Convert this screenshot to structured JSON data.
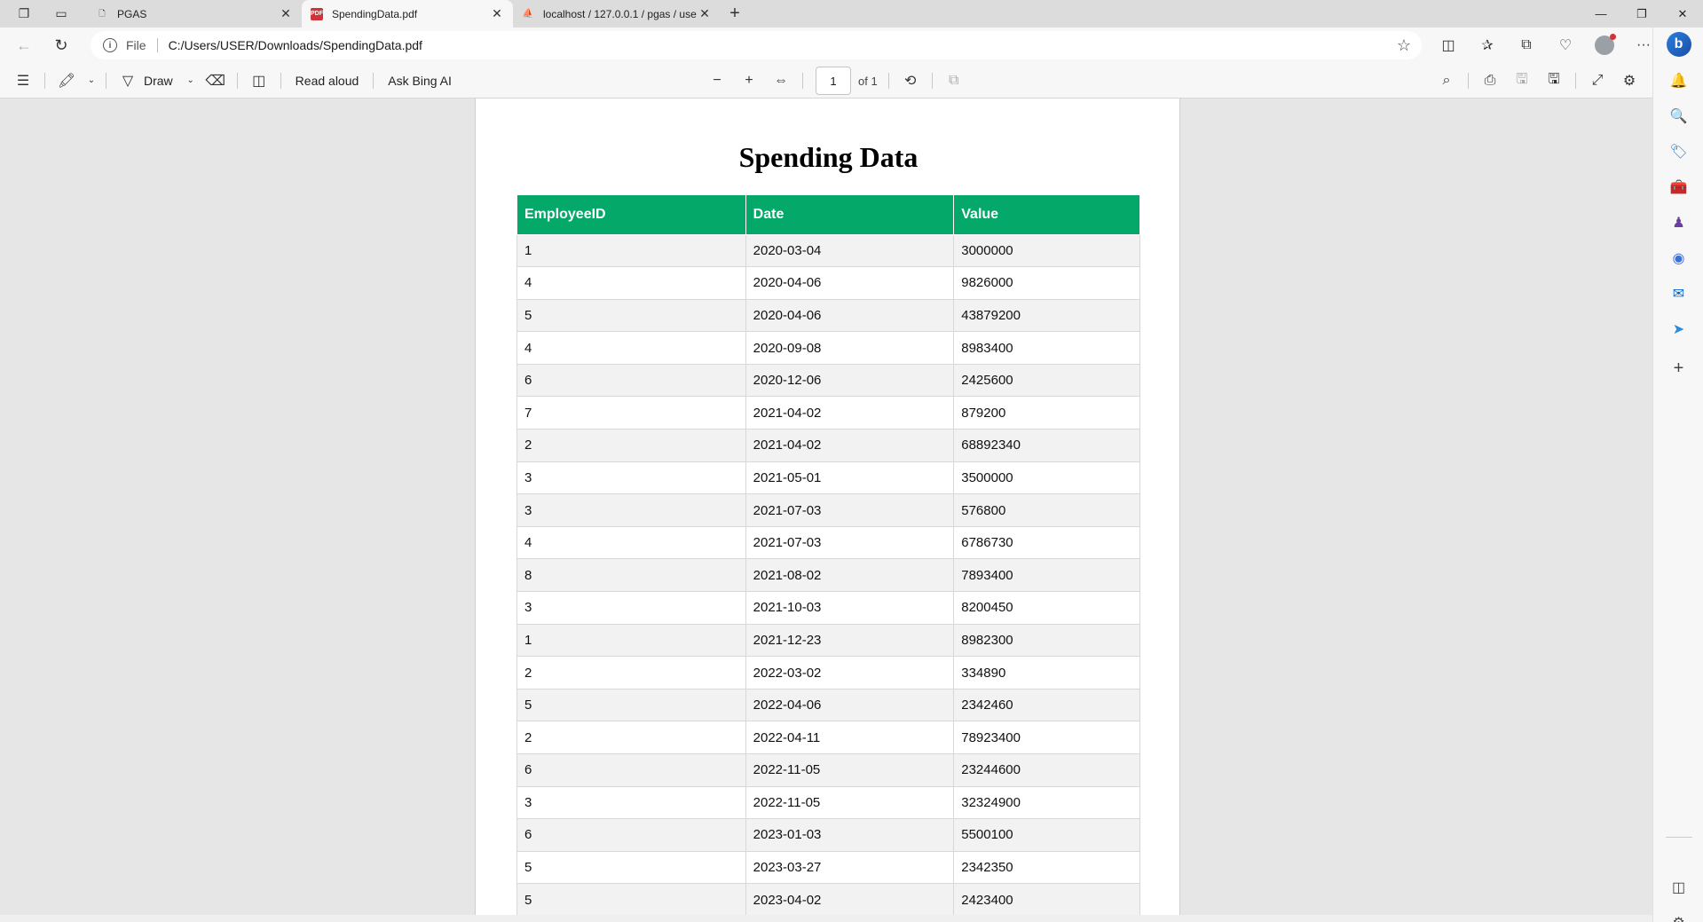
{
  "browser": {
    "tabs": [
      {
        "title": "PGAS",
        "active": false
      },
      {
        "title": "SpendingData.pdf",
        "active": true
      },
      {
        "title": "localhost / 127.0.0.1 / pgas / use",
        "active": false
      }
    ],
    "address": {
      "scheme": "File",
      "url": "C:/Users/USER/Downloads/SpendingData.pdf"
    }
  },
  "pdf_toolbar": {
    "draw_label": "Draw",
    "read_aloud_label": "Read aloud",
    "ask_bing_label": "Ask Bing AI",
    "page_number": "1",
    "page_count": "of 1"
  },
  "document": {
    "title": "Spending Data",
    "columns": [
      "EmployeeID",
      "Date",
      "Value"
    ],
    "header_color": "#04a869",
    "rows": [
      [
        "1",
        "2020-03-04",
        "3000000"
      ],
      [
        "4",
        "2020-04-06",
        "9826000"
      ],
      [
        "5",
        "2020-04-06",
        "43879200"
      ],
      [
        "4",
        "2020-09-08",
        "8983400"
      ],
      [
        "6",
        "2020-12-06",
        "2425600"
      ],
      [
        "7",
        "2021-04-02",
        "879200"
      ],
      [
        "2",
        "2021-04-02",
        "68892340"
      ],
      [
        "3",
        "2021-05-01",
        "3500000"
      ],
      [
        "3",
        "2021-07-03",
        "576800"
      ],
      [
        "4",
        "2021-07-03",
        "6786730"
      ],
      [
        "8",
        "2021-08-02",
        "7893400"
      ],
      [
        "3",
        "2021-10-03",
        "8200450"
      ],
      [
        "1",
        "2021-12-23",
        "8982300"
      ],
      [
        "2",
        "2022-03-02",
        "334890"
      ],
      [
        "5",
        "2022-04-06",
        "2342460"
      ],
      [
        "2",
        "2022-04-11",
        "78923400"
      ],
      [
        "6",
        "2022-11-05",
        "23244600"
      ],
      [
        "3",
        "2022-11-05",
        "32324900"
      ],
      [
        "6",
        "2023-01-03",
        "5500100"
      ],
      [
        "5",
        "2023-03-27",
        "2342350"
      ],
      [
        "5",
        "2023-04-02",
        "2423400"
      ]
    ]
  }
}
